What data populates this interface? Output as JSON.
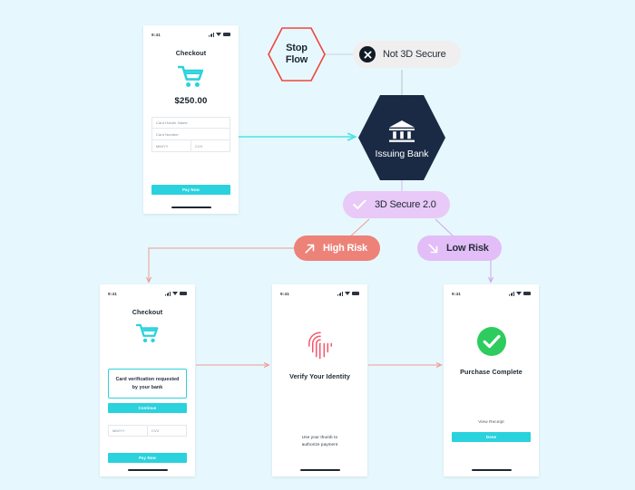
{
  "theme": {
    "background": "#e6f8fd",
    "accent_teal": "#2ad2dd",
    "navy": "#1b2a44",
    "salmon": "#ed8279",
    "purple": "#e3bdf7",
    "purple_light": "#e8c9f7",
    "green": "#2ecc5e",
    "stop_red": "#f0453c"
  },
  "flow": {
    "stop_node": {
      "name": "stop-flow",
      "line1": "Stop",
      "line2": "Flow"
    },
    "not_secure": {
      "label": "Not 3D Secure",
      "icon": "close-circle-icon"
    },
    "issuing_bank": {
      "label": "Issuing Bank",
      "icon": "bank-icon"
    },
    "three_ds": {
      "label": "3D Secure 2.0",
      "icon": "check-icon"
    },
    "high_risk": {
      "label": "High Risk",
      "icon": "arrow-up-right-icon"
    },
    "low_risk": {
      "label": "Low Risk",
      "icon": "arrow-down-right-icon"
    }
  },
  "phones": {
    "checkout": {
      "status": {
        "time": "9:41"
      },
      "title": "Checkout",
      "cart_icon": "shopping-cart-icon",
      "price": "$250.00",
      "fields": [
        {
          "placeholder": "Card Holder Name"
        },
        {
          "placeholder": "Card Number"
        }
      ],
      "small_fields": [
        {
          "placeholder": "MM/YY"
        },
        {
          "placeholder": "CVV"
        }
      ],
      "cta": "Pay Now"
    },
    "verification": {
      "status": {
        "time": "9:41"
      },
      "title": "Checkout",
      "cart_icon": "shopping-cart-icon",
      "notice": "Card verification requested by your bank",
      "continue_cta": "Continue",
      "small_fields": [
        {
          "placeholder": "MM/YY"
        },
        {
          "placeholder": "CVV"
        }
      ],
      "cta": "Pay Now"
    },
    "identity": {
      "status": {
        "time": "9:41"
      },
      "icon": "fingerprint-icon",
      "title": "Verify Your Identity",
      "hint_line1": "Use your thumb to",
      "hint_line2": "authorize payment"
    },
    "complete": {
      "status": {
        "time": "9:41"
      },
      "icon": "check-circle-icon",
      "title": "Purchase Complete",
      "receipt_link": "View Receipt",
      "cta": "Done"
    }
  }
}
